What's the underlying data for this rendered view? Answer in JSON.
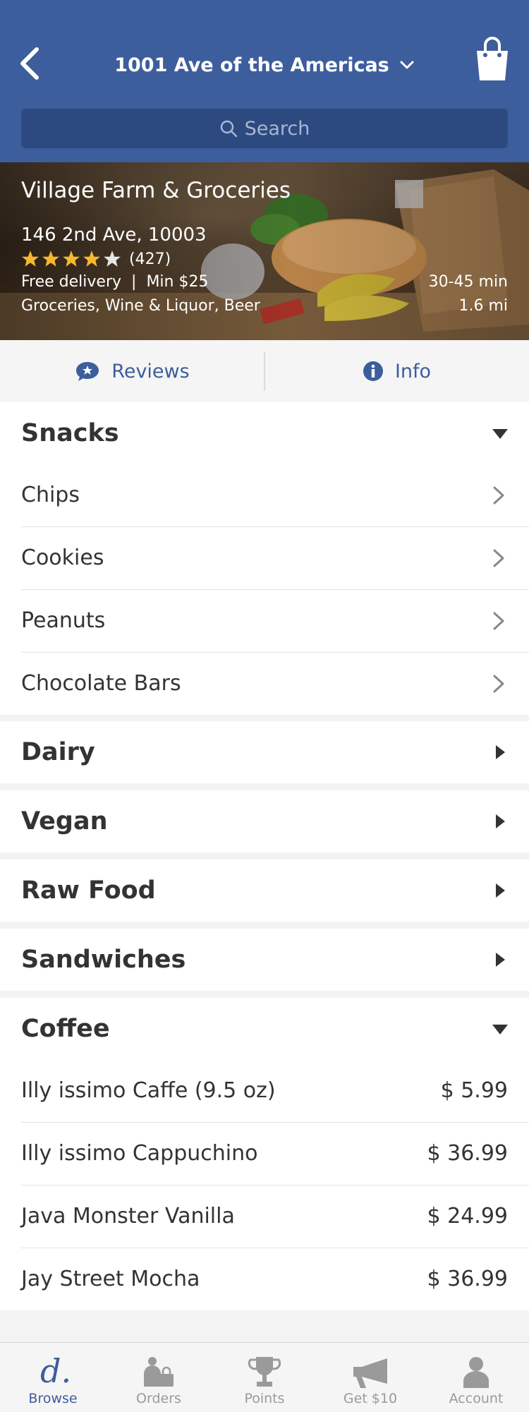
{
  "header": {
    "location": "1001 Ave of the Americas",
    "search_placeholder": "Search"
  },
  "store": {
    "name": "Village Farm & Groceries",
    "address": "146 2nd Ave, 10003",
    "rating": 4,
    "rating_max": 5,
    "review_count": "(427)",
    "delivery": "Free delivery",
    "minimum": "Min $25",
    "categories": "Groceries, Wine & Liquor, Beer",
    "eta": "30-45 min",
    "distance": "1.6 mi"
  },
  "tabs": {
    "reviews": "Reviews",
    "info": "Info"
  },
  "sections": {
    "snacks": {
      "title": "Snacks",
      "items": [
        "Chips",
        "Cookies",
        "Peanuts",
        "Chocolate Bars"
      ]
    },
    "dairy": {
      "title": "Dairy"
    },
    "vegan": {
      "title": "Vegan"
    },
    "raw_food": {
      "title": "Raw Food"
    },
    "sandwiches": {
      "title": "Sandwiches"
    },
    "coffee": {
      "title": "Coffee",
      "items": [
        {
          "name": "Illy issimo Caffe (9.5 oz)",
          "price": "$ 5.99"
        },
        {
          "name": "Illy issimo Cappuchino",
          "price": "$ 36.99"
        },
        {
          "name": "Java Monster Vanilla",
          "price": "$ 24.99"
        },
        {
          "name": "Jay Street Mocha",
          "price": "$ 36.99"
        }
      ]
    }
  },
  "bottom_nav": [
    {
      "label": "Browse",
      "icon": "browse-logo-icon",
      "active": true
    },
    {
      "label": "Orders",
      "icon": "orders-icon",
      "active": false
    },
    {
      "label": "Points",
      "icon": "trophy-icon",
      "active": false
    },
    {
      "label": "Get $10",
      "icon": "megaphone-icon",
      "active": false
    },
    {
      "label": "Account",
      "icon": "person-icon",
      "active": false
    }
  ],
  "colors": {
    "brand_blue": "#3d5e9c",
    "search_bg": "#2c4a80",
    "star_gold": "#f5b82e",
    "inactive_gray": "#9a9a9a"
  }
}
